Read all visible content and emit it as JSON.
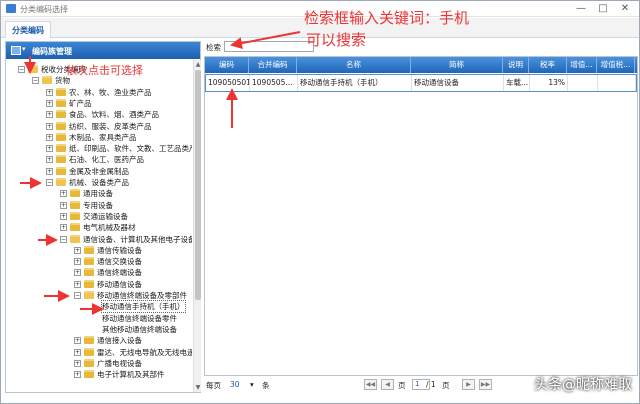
{
  "window": {
    "title": "分类编码选择",
    "minimize": "—",
    "maximize": "□",
    "close": "✕"
  },
  "tabs": [
    {
      "label": "分类编码"
    }
  ],
  "left_panel": {
    "header": "编码族管理"
  },
  "tree": [
    {
      "label": "税收分类编码",
      "depth": 0,
      "expander": "−"
    },
    {
      "label": "货物",
      "depth": 1,
      "expander": "−"
    },
    {
      "label": "农、林、牧、渔业类产品",
      "depth": 2,
      "expander": "+"
    },
    {
      "label": "矿产品",
      "depth": 2,
      "expander": "+"
    },
    {
      "label": "食品、饮料、烟、酒类产品",
      "depth": 2,
      "expander": "+"
    },
    {
      "label": "纺织、服装、皮革类产品",
      "depth": 2,
      "expander": "+"
    },
    {
      "label": "木制品、家具类产品",
      "depth": 2,
      "expander": "+"
    },
    {
      "label": "纸、印刷品、软件、文教、工艺品类产品",
      "depth": 2,
      "expander": "+"
    },
    {
      "label": "石油、化工、医药产品",
      "depth": 2,
      "expander": "+"
    },
    {
      "label": "金属及非金属制品",
      "depth": 2,
      "expander": "+"
    },
    {
      "label": "机械、设备类产品",
      "depth": 2,
      "expander": "−"
    },
    {
      "label": "通用设备",
      "depth": 3,
      "expander": "+"
    },
    {
      "label": "专用设备",
      "depth": 3,
      "expander": "+"
    },
    {
      "label": "交通运输设备",
      "depth": 3,
      "expander": "+"
    },
    {
      "label": "电气机械及器材",
      "depth": 3,
      "expander": "+"
    },
    {
      "label": "通信设备、计算机及其他电子设备",
      "depth": 3,
      "expander": "−"
    },
    {
      "label": "通信传输设备",
      "depth": 4,
      "expander": "+"
    },
    {
      "label": "通信交换设备",
      "depth": 4,
      "expander": "+"
    },
    {
      "label": "通信终端设备",
      "depth": 4,
      "expander": "+"
    },
    {
      "label": "移动通信设备",
      "depth": 4,
      "expander": "+"
    },
    {
      "label": "移动通信终端设备及零部件",
      "depth": 4,
      "expander": "−"
    },
    {
      "label": "移动通信手持机（手机）",
      "depth": 5,
      "expander": "",
      "selected": true
    },
    {
      "label": "移动通信终端设备零件",
      "depth": 5,
      "expander": ""
    },
    {
      "label": "其他移动通信终端设备",
      "depth": 5,
      "expander": ""
    },
    {
      "label": "通信接入设备",
      "depth": 4,
      "expander": "+"
    },
    {
      "label": "雷达、无线电导航及无线电遥控",
      "depth": 4,
      "expander": "+"
    },
    {
      "label": "广播电视设备",
      "depth": 4,
      "expander": "+"
    },
    {
      "label": "电子计算机及其部件",
      "depth": 4,
      "expander": "+"
    }
  ],
  "search": {
    "label": "检索",
    "value": ""
  },
  "grid": {
    "columns": [
      "编码",
      "合并编码",
      "名称",
      "简称",
      "说明",
      "税率",
      "增值...",
      "增值税..."
    ],
    "rows": [
      [
        "109050501",
        "1090505...",
        "移动通信手持机（手机）",
        "移动通信设备",
        "车载...",
        "13%",
        "",
        ""
      ]
    ]
  },
  "pager": {
    "per_page_label": "每页",
    "per_page_value": "30",
    "unit": "条",
    "page_label": "页",
    "current_page": "1",
    "total": "/ 1",
    "total_suffix": "页"
  },
  "annotations": {
    "search_note_line1": "检索框输入关键词：手机",
    "search_note_line2": "可以搜索",
    "tree_note": "依次点击可选择",
    "color": "#e53333"
  },
  "watermark": "头条@昵称难取"
}
